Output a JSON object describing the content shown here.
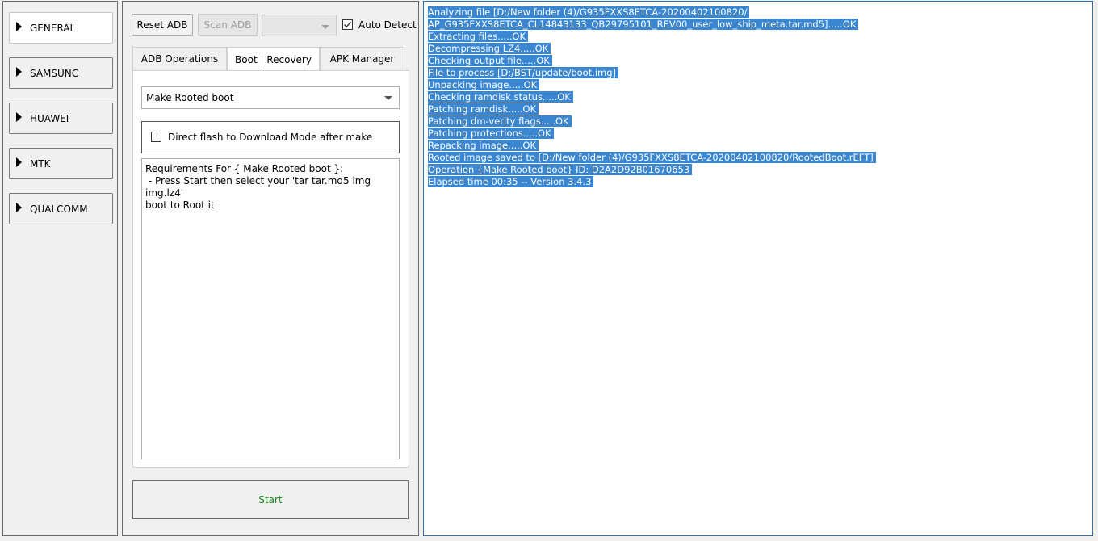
{
  "nav": {
    "items": [
      {
        "label": "GENERAL",
        "active": true
      },
      {
        "label": "SAMSUNG",
        "active": false
      },
      {
        "label": "HUAWEI",
        "active": false
      },
      {
        "label": "MTK",
        "active": false
      },
      {
        "label": "QUALCOMM",
        "active": false
      }
    ]
  },
  "toolbar": {
    "reset_adb_label": "Reset ADB",
    "scan_adb_label": "Scan ADB",
    "device_combo_value": "",
    "auto_detect_label": "Auto Detect",
    "auto_detect_checked": true
  },
  "tabs": [
    {
      "label": "ADB Operations",
      "active": false
    },
    {
      "label": "Boot | Recovery",
      "active": true
    },
    {
      "label": "APK Manager",
      "active": false
    }
  ],
  "boot": {
    "mode_value": "Make Rooted boot",
    "direct_flash_label": "Direct flash to Download Mode after make",
    "direct_flash_checked": false,
    "requirements_text": "Requirements For { Make Rooted boot }:\n - Press Start then select your 'tar tar.md5 img img.lz4'\nboot to Root it"
  },
  "start_label": "Start",
  "colors": {
    "start_text": "#1a8c1a",
    "log_selection_bg": "#3a86d0",
    "log_selection_text": "#ffffff"
  },
  "log": {
    "lines": [
      "Analyzing file [D:/New folder (4)/G935FXXS8ETCA-20200402100820/",
      "AP_G935FXXS8ETCA_CL14843133_QB29795101_REV00_user_low_ship_meta.tar.md5].....OK",
      "Extracting files.....OK",
      "Decompressing LZ4.....OK",
      "Checking output file.....OK",
      "File to process [D:/BST/update/boot.img]",
      "Unpacking image.....OK",
      "Checking ramdisk status.....OK",
      "Patching ramdisk.....OK",
      "Patching dm-verity flags.....OK",
      "Patching protections.....OK",
      "Repacking image.....OK",
      "Rooted image saved to [D:/New folder (4)/G935FXXS8ETCA-20200402100820/RootedBoot.rEFT]",
      "Operation {Make Rooted boot} ID: D2A2D92B01670653",
      "Elapsed time 00:35 -- Version 3.4.3"
    ]
  }
}
